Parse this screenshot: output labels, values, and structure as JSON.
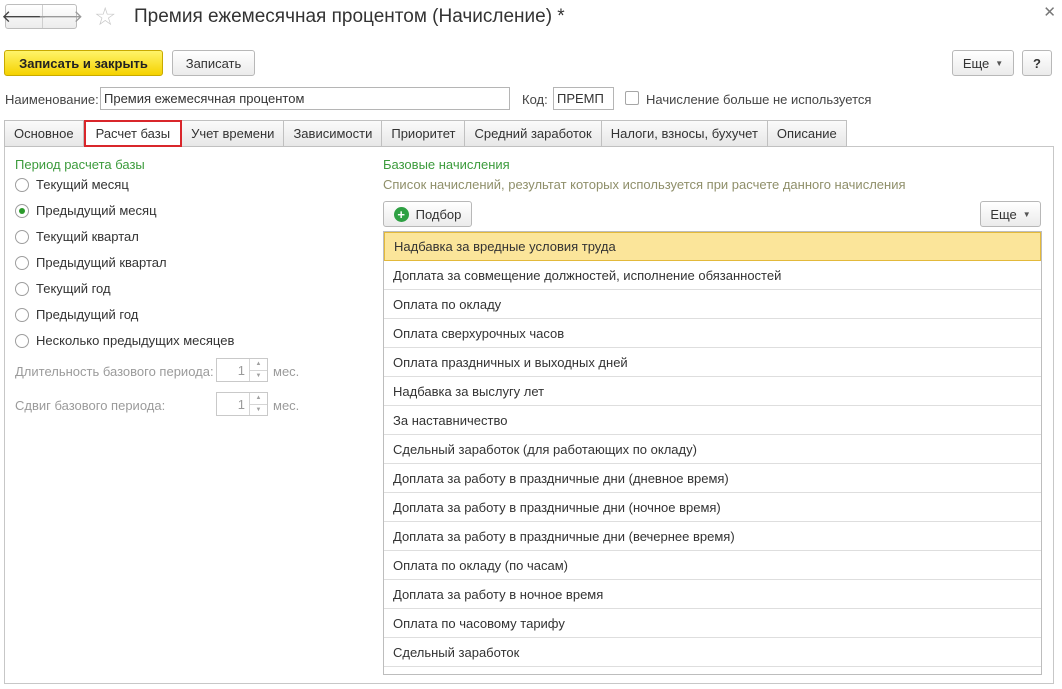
{
  "window": {
    "title": "Премия ежемесячная процентом (Начисление) *",
    "back_icon": "arrow-left-icon",
    "forward_icon": "arrow-right-icon",
    "favorite_icon": "star-icon",
    "close_icon": "close-icon"
  },
  "toolbar": {
    "save_close_label": "Записать и закрыть",
    "save_label": "Записать",
    "more_label": "Еще",
    "help_label": "?"
  },
  "header_fields": {
    "name_label": "Наименование:",
    "name_value": "Премия ежемесячная процентом",
    "code_label": "Код:",
    "code_value": "ПРЕМП",
    "unused_checkbox_label": "Начисление больше не используется"
  },
  "tabs": [
    {
      "label": "Основное"
    },
    {
      "label": "Расчет базы"
    },
    {
      "label": "Учет времени"
    },
    {
      "label": "Зависимости"
    },
    {
      "label": "Приоритет"
    },
    {
      "label": "Средний заработок"
    },
    {
      "label": "Налоги, взносы, бухучет"
    },
    {
      "label": "Описание"
    }
  ],
  "active_tab": "Расчет базы",
  "period": {
    "title": "Период расчета базы",
    "options": [
      {
        "label": "Текущий месяц",
        "checked": false
      },
      {
        "label": "Предыдущий месяц",
        "checked": true
      },
      {
        "label": "Текущий квартал",
        "checked": false
      },
      {
        "label": "Предыдущий квартал",
        "checked": false
      },
      {
        "label": "Текущий год",
        "checked": false
      },
      {
        "label": "Предыдущий год",
        "checked": false
      },
      {
        "label": "Несколько предыдущих месяцев",
        "checked": false
      }
    ],
    "duration_label": "Длительность базового периода:",
    "duration_value": "1",
    "shift_label": "Сдвиг базового периода:",
    "shift_value": "1",
    "unit_label": "мес."
  },
  "base_accruals": {
    "title": "Базовые начисления",
    "subtitle": "Список начислений, результат которых используется при расчете данного начисления",
    "pick_label": "Подбор",
    "more_label": "Еще",
    "items": [
      "Надбавка за вредные условия труда",
      "Доплата за совмещение должностей, исполнение обязанностей",
      "Оплата по окладу",
      "Оплата сверхурочных часов",
      "Оплата праздничных и выходных дней",
      "Надбавка за выслугу лет",
      "За наставничество",
      "Сдельный заработок (для работающих по окладу)",
      "Доплата за работу в праздничные дни (дневное время)",
      "Доплата за работу в праздничные дни (ночное время)",
      "Доплата за работу в праздничные дни (вечернее время)",
      "Оплата по окладу (по часам)",
      "Доплата за работу в ночное время",
      "Оплата по часовому тарифу",
      "Сдельный заработок"
    ],
    "selected_index": 0
  },
  "colors": {
    "primary_button": "#f5d200",
    "group_title": "#3c9b3c",
    "selection": "#fbe59a",
    "active_tab_outline": "#d9262b"
  }
}
